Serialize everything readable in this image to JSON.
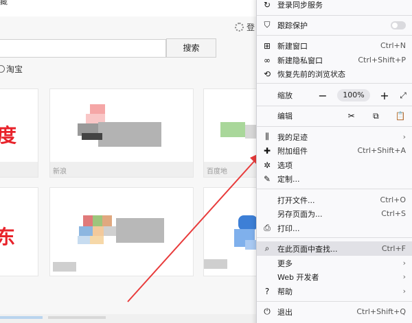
{
  "page": {
    "top_fragment": "藏",
    "login_text": "登",
    "search_button": "搜索",
    "search_option": "淘宝",
    "tile_text_baidu": "度",
    "tile_text_jd": "东",
    "tile_caption_1": "新浪",
    "tile_caption_2": "百度地",
    "bottom_caption": "淘宝"
  },
  "menu": {
    "sync_label": "登录同步服务",
    "tracking_label": "跟踪保护",
    "new_window": {
      "label": "新建窗口",
      "shortcut": "Ctrl+N"
    },
    "new_private": {
      "label": "新建隐私窗口",
      "shortcut": "Ctrl+Shift+P"
    },
    "restore_session": {
      "label": "恢复先前的浏览状态"
    },
    "zoom": {
      "label": "缩放",
      "minus": "−",
      "value": "100%",
      "plus": "+",
      "fullscreen": "⤢"
    },
    "edit": {
      "label": "编辑",
      "cut": "✂",
      "copy": "⧉",
      "paste": "📋"
    },
    "library": {
      "label": "我的足迹",
      "chevron": "›"
    },
    "addons": {
      "label": "附加组件",
      "shortcut": "Ctrl+Shift+A"
    },
    "options": {
      "label": "选项"
    },
    "customize": {
      "label": "定制..."
    },
    "open_file": {
      "label": "打开文件...",
      "shortcut": "Ctrl+O"
    },
    "save_page": {
      "label": "另存页面为...",
      "shortcut": "Ctrl+S"
    },
    "print": {
      "label": "打印..."
    },
    "find": {
      "label": "在此页面中查找...",
      "shortcut": "Ctrl+F"
    },
    "more": {
      "label": "更多",
      "chevron": "›"
    },
    "web_dev": {
      "label": "Web 开发者",
      "chevron": "›"
    },
    "help": {
      "label": "帮助",
      "chevron": "›"
    },
    "quit": {
      "label": "退出",
      "shortcut": "Ctrl+Shift+Q"
    }
  },
  "colors": {
    "arrow": "#e83b3b",
    "brand_red": "#e8222a",
    "menu_bg": "#f9f9fb",
    "highlight": "#e1e1e6"
  }
}
